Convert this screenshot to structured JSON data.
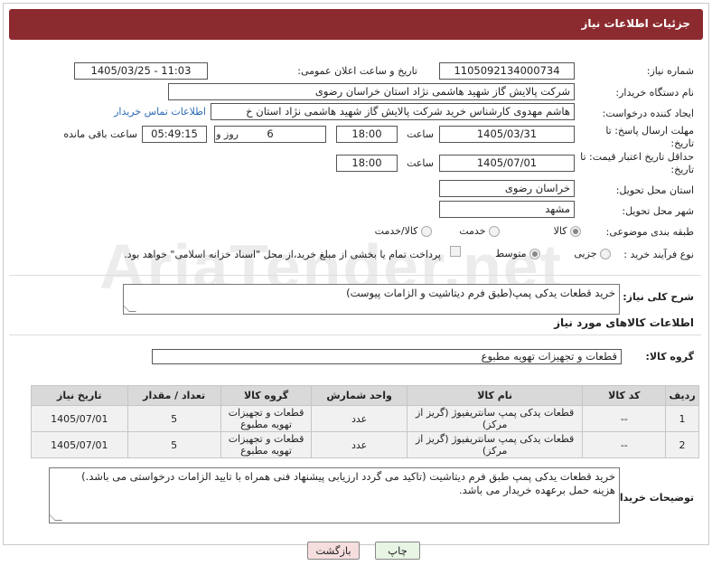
{
  "header": {
    "title": "جزئیات اطلاعات نیاز"
  },
  "form": {
    "need_number_label": "شماره نیاز:",
    "need_number": "1105092134000734",
    "announce_label": "تاریخ و ساعت اعلان عمومی:",
    "announce_value": "1405/03/25 - 11:03",
    "buyer_label": "نام دستگاه خریدار:",
    "buyer_value": "شرکت پالایش گاز شهید هاشمی نژاد   استان خراسان رضوی",
    "creator_label": "ایجاد کننده درخواست:",
    "creator_value": "هاشم مهدوی کارشناس خرید شرکت پالایش گاز شهید هاشمی نژاد   استان خ",
    "contact_link": "اطلاعات تماس خریدار",
    "deadline_label": "مهلت ارسال پاسخ: تا تاریخ:",
    "deadline_date": "1405/03/31",
    "time_label": "ساعت",
    "deadline_time": "18:00",
    "days_value": "6",
    "days_label": "روز و",
    "remaining_time": "05:49:15",
    "remaining_label": "ساعت باقی مانده",
    "price_validity_label": "حداقل تاریخ اعتبار قیمت: تا تاریخ:",
    "price_validity_date": "1405/07/01",
    "price_validity_time": "18:00",
    "province_label": "استان محل تحویل:",
    "province_value": "خراسان رضوی",
    "city_label": "شهر محل تحویل:",
    "city_value": "مشهد",
    "category_label": "طبقه بندی موضوعی:",
    "category_options": [
      "کالا",
      "خدمت",
      "کالا/خدمت"
    ],
    "category_selected": "کالا",
    "process_label": "نوع فرآیند خرید :",
    "process_options": [
      "جزیی",
      "متوسط"
    ],
    "process_selected": "متوسط",
    "payment_note": "پرداخت تمام یا بخشی از مبلغ خرید،از محل \"اسناد خزانه اسلامی\" خواهد بود."
  },
  "description": {
    "label": "شرح کلی نیاز:",
    "value": "خرید قطعات یدکی پمپ(طبق فرم دیتاشیت و الزامات پیوست)"
  },
  "items_section": {
    "title": "اطلاعات کالاهای مورد نیاز",
    "group_label": "گروه کالا:",
    "group_value": "قطعات و تجهیزات تهویه مطبوع",
    "columns": [
      "ردیف",
      "کد کالا",
      "نام کالا",
      "واحد شمارش",
      "گروه کالا",
      "تعداد / مقدار",
      "تاریخ نیاز"
    ],
    "rows": [
      [
        "1",
        "--",
        "قطعات یدکی پمپ سانتریفیوژ (گریز از مرکز)",
        "عدد",
        "قطعات و تجهیزات تهویه مطبوع",
        "5",
        "1405/07/01"
      ],
      [
        "2",
        "--",
        "قطعات یدکی پمپ سانتریفیوژ (گریز از مرکز)",
        "عدد",
        "قطعات و تجهیزات تهویه مطبوع",
        "5",
        "1405/07/01"
      ]
    ]
  },
  "buyer_notes": {
    "label": "توضیحات خریدار:",
    "line1": "خرید قطعات یدکی پمپ طبق فرم دیتاشیت (تاکید می گردد ارزیابی پیشنهاد فنی همراه با تایید الزامات درخواستی می باشد.)",
    "line2": "هزینه حمل برعهده خریدار می باشد."
  },
  "buttons": {
    "print": "چاپ",
    "back": "بازگشت"
  },
  "watermark": "AriaTender.net",
  "colors": {
    "header_bg": "#8c2b2f",
    "link": "#2a6bb3",
    "back_btn_bg": "#f6dede",
    "print_btn_bg": "#e8f4e4"
  }
}
